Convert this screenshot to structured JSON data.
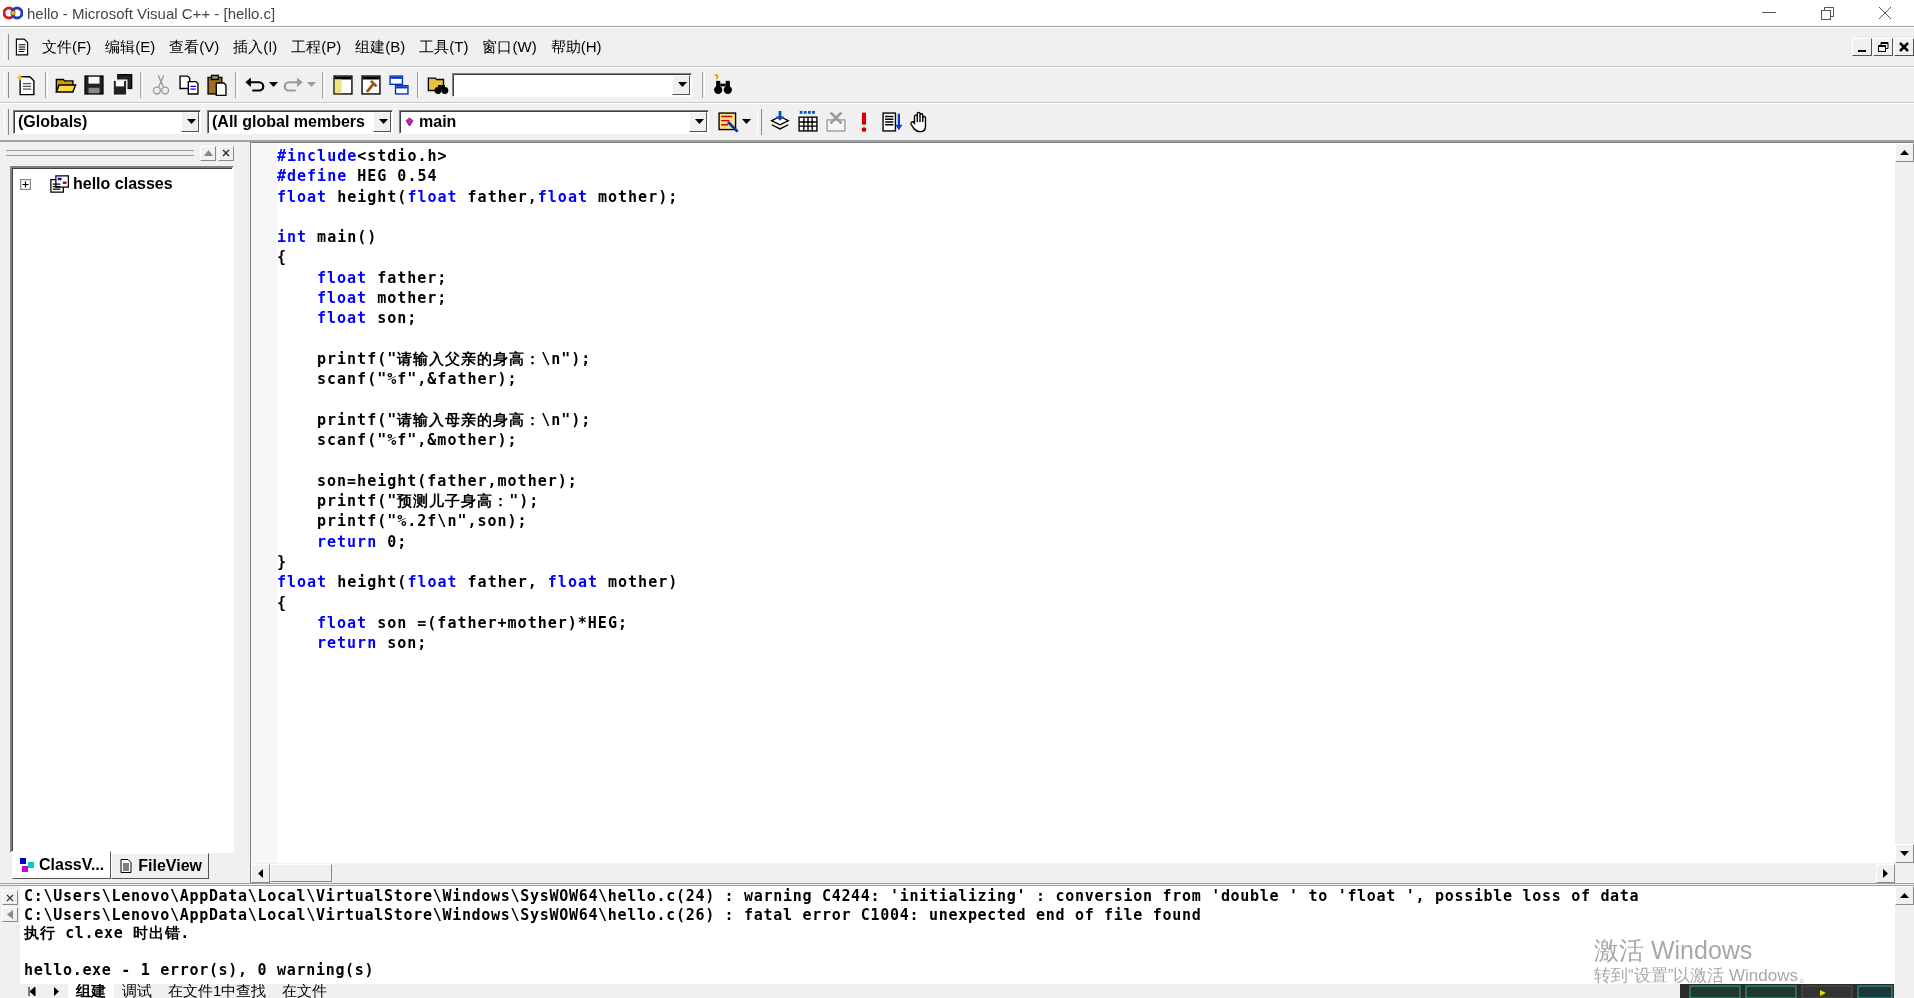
{
  "window": {
    "title": "hello - Microsoft Visual C++ - [hello.c]"
  },
  "menu": [
    "文件(F)",
    "编辑(E)",
    "查看(V)",
    "插入(I)",
    "工程(P)",
    "组建(B)",
    "工具(T)",
    "窗口(W)",
    "帮助(H)"
  ],
  "standard_toolbar": [
    {
      "kind": "new",
      "disabled": false
    },
    {
      "kind": "sep"
    },
    {
      "kind": "open",
      "disabled": false
    },
    {
      "kind": "save",
      "disabled": false
    },
    {
      "kind": "save_all",
      "disabled": false
    },
    {
      "kind": "sep"
    },
    {
      "kind": "cut",
      "disabled": true
    },
    {
      "kind": "copy",
      "disabled": false
    },
    {
      "kind": "paste",
      "disabled": false
    },
    {
      "kind": "sep"
    },
    {
      "kind": "undo",
      "disabled": false
    },
    {
      "kind": "redo",
      "disabled": true
    },
    {
      "kind": "sep"
    },
    {
      "kind": "workspace",
      "disabled": false
    },
    {
      "kind": "output",
      "disabled": false
    },
    {
      "kind": "window_list",
      "disabled": false
    },
    {
      "kind": "sep"
    },
    {
      "kind": "find_in_files",
      "disabled": false
    },
    {
      "kind": "combo"
    },
    {
      "kind": "sep"
    },
    {
      "kind": "find",
      "disabled": false
    }
  ],
  "wizard_bar": {
    "class_combo": "(Globals)",
    "filter_combo": "(All global members",
    "member_combo": "main"
  },
  "build_toolbar": [
    {
      "kind": "compile",
      "disabled": false
    },
    {
      "kind": "build",
      "disabled": false
    },
    {
      "kind": "stop",
      "disabled": true
    },
    {
      "kind": "execute",
      "disabled": false
    },
    {
      "kind": "go",
      "disabled": false
    },
    {
      "kind": "breakpoint",
      "disabled": false
    }
  ],
  "workspace": {
    "tree": [
      {
        "label": "hello classes",
        "expanded": false
      }
    ],
    "tabs": [
      {
        "label": "ClassV...",
        "selected": true
      },
      {
        "label": "FileView",
        "selected": false
      }
    ]
  },
  "editor": {
    "lines": [
      {
        "kind": "code",
        "indented": false,
        "tokens": [
          {
            "text": "#include",
            "kind": "keyword"
          },
          {
            "text": "<stdio.h>",
            "kind": "plain"
          }
        ]
      },
      {
        "kind": "code",
        "indented": false,
        "tokens": [
          {
            "text": "#define",
            "kind": "keyword"
          },
          {
            "text": " HEG 0.54",
            "kind": "plain"
          }
        ]
      },
      {
        "kind": "code",
        "indented": false,
        "tokens": [
          {
            "text": "float",
            "kind": "keyword"
          },
          {
            "text": " height(",
            "kind": "plain"
          },
          {
            "text": "float",
            "kind": "keyword"
          },
          {
            "text": " father,",
            "kind": "plain"
          },
          {
            "text": "float",
            "kind": "keyword"
          },
          {
            "text": " mother);",
            "kind": "plain"
          }
        ]
      },
      {
        "kind": "blank"
      },
      {
        "kind": "code",
        "indented": false,
        "tokens": [
          {
            "text": "int",
            "kind": "keyword"
          },
          {
            "text": " main()",
            "kind": "plain"
          }
        ]
      },
      {
        "kind": "code",
        "indented": false,
        "tokens": [
          {
            "text": "{",
            "kind": "plain"
          }
        ]
      },
      {
        "kind": "code",
        "indented": true,
        "tokens": [
          {
            "text": "float",
            "kind": "keyword"
          },
          {
            "text": " father;",
            "kind": "plain"
          }
        ]
      },
      {
        "kind": "code",
        "indented": true,
        "tokens": [
          {
            "text": "float",
            "kind": "keyword"
          },
          {
            "text": " mother;",
            "kind": "plain"
          }
        ]
      },
      {
        "kind": "code",
        "indented": true,
        "tokens": [
          {
            "text": "float",
            "kind": "keyword"
          },
          {
            "text": " son;",
            "kind": "plain"
          }
        ]
      },
      {
        "kind": "blank"
      },
      {
        "kind": "code",
        "indented": true,
        "tokens": [
          {
            "text": "printf(\"请输入父亲的身高：\\n\");",
            "kind": "plain"
          }
        ]
      },
      {
        "kind": "code",
        "indented": true,
        "tokens": [
          {
            "text": "scanf(\"%f\",&father);",
            "kind": "plain"
          }
        ]
      },
      {
        "kind": "blank"
      },
      {
        "kind": "code",
        "indented": true,
        "tokens": [
          {
            "text": "printf(\"请输入母亲的身高：\\n\");",
            "kind": "plain"
          }
        ]
      },
      {
        "kind": "code",
        "indented": true,
        "tokens": [
          {
            "text": "scanf(\"%f\",&mother);",
            "kind": "plain"
          }
        ]
      },
      {
        "kind": "blank"
      },
      {
        "kind": "code",
        "indented": true,
        "tokens": [
          {
            "text": "son=height(father,mother);",
            "kind": "plain"
          }
        ]
      },
      {
        "kind": "code",
        "indented": true,
        "tokens": [
          {
            "text": "printf(\"预测儿子身高：\");",
            "kind": "plain"
          }
        ]
      },
      {
        "kind": "code",
        "indented": true,
        "tokens": [
          {
            "text": "printf(\"%.2f\\n\",son);",
            "kind": "plain"
          }
        ]
      },
      {
        "kind": "code",
        "indented": true,
        "tokens": [
          {
            "text": "return",
            "kind": "keyword"
          },
          {
            "text": " 0;",
            "kind": "plain"
          }
        ]
      },
      {
        "kind": "code",
        "indented": false,
        "tokens": [
          {
            "text": "}",
            "kind": "plain"
          }
        ]
      },
      {
        "kind": "code",
        "indented": false,
        "tokens": [
          {
            "text": "float",
            "kind": "keyword"
          },
          {
            "text": " height(",
            "kind": "plain"
          },
          {
            "text": "float",
            "kind": "keyword"
          },
          {
            "text": " father, ",
            "kind": "plain"
          },
          {
            "text": "float",
            "kind": "keyword"
          },
          {
            "text": " mother)",
            "kind": "plain"
          }
        ]
      },
      {
        "kind": "code",
        "indented": false,
        "tokens": [
          {
            "text": "{",
            "kind": "plain"
          }
        ]
      },
      {
        "kind": "code",
        "indented": true,
        "tokens": [
          {
            "text": "float",
            "kind": "keyword"
          },
          {
            "text": " son =(father+mother)*HEG;",
            "kind": "plain"
          }
        ]
      },
      {
        "kind": "code",
        "indented": true,
        "tokens": [
          {
            "text": "return",
            "kind": "keyword"
          },
          {
            "text": " son;",
            "kind": "plain"
          }
        ]
      }
    ]
  },
  "output": {
    "lines": [
      {
        "kind": "message",
        "text": "C:\\Users\\Lenovo\\AppData\\Local\\VirtualStore\\Windows\\SysWOW64\\hello.c(24) : warning C4244: 'initializing' : conversion from 'double ' to 'float ', possible loss of data"
      },
      {
        "kind": "message",
        "text": "C:\\Users\\Lenovo\\AppData\\Local\\VirtualStore\\Windows\\SysWOW64\\hello.c(26) : fatal error C1004: unexpected end of file found"
      },
      {
        "kind": "message",
        "text": "执行 cl.exe 时出错."
      },
      {
        "kind": "blank"
      },
      {
        "kind": "message",
        "text": "hello.exe - 1 error(s), 0 warning(s)"
      }
    ],
    "tabs": [
      {
        "label": "组建",
        "selected": true
      },
      {
        "label": "调试",
        "selected": false
      },
      {
        "label": "在文件1中查找",
        "selected": false
      },
      {
        "label": "在文件",
        "selected": false
      }
    ]
  },
  "activation_notice": {
    "title": "激活 Windows",
    "hint": "转到“设置”以激活 Windows。"
  }
}
